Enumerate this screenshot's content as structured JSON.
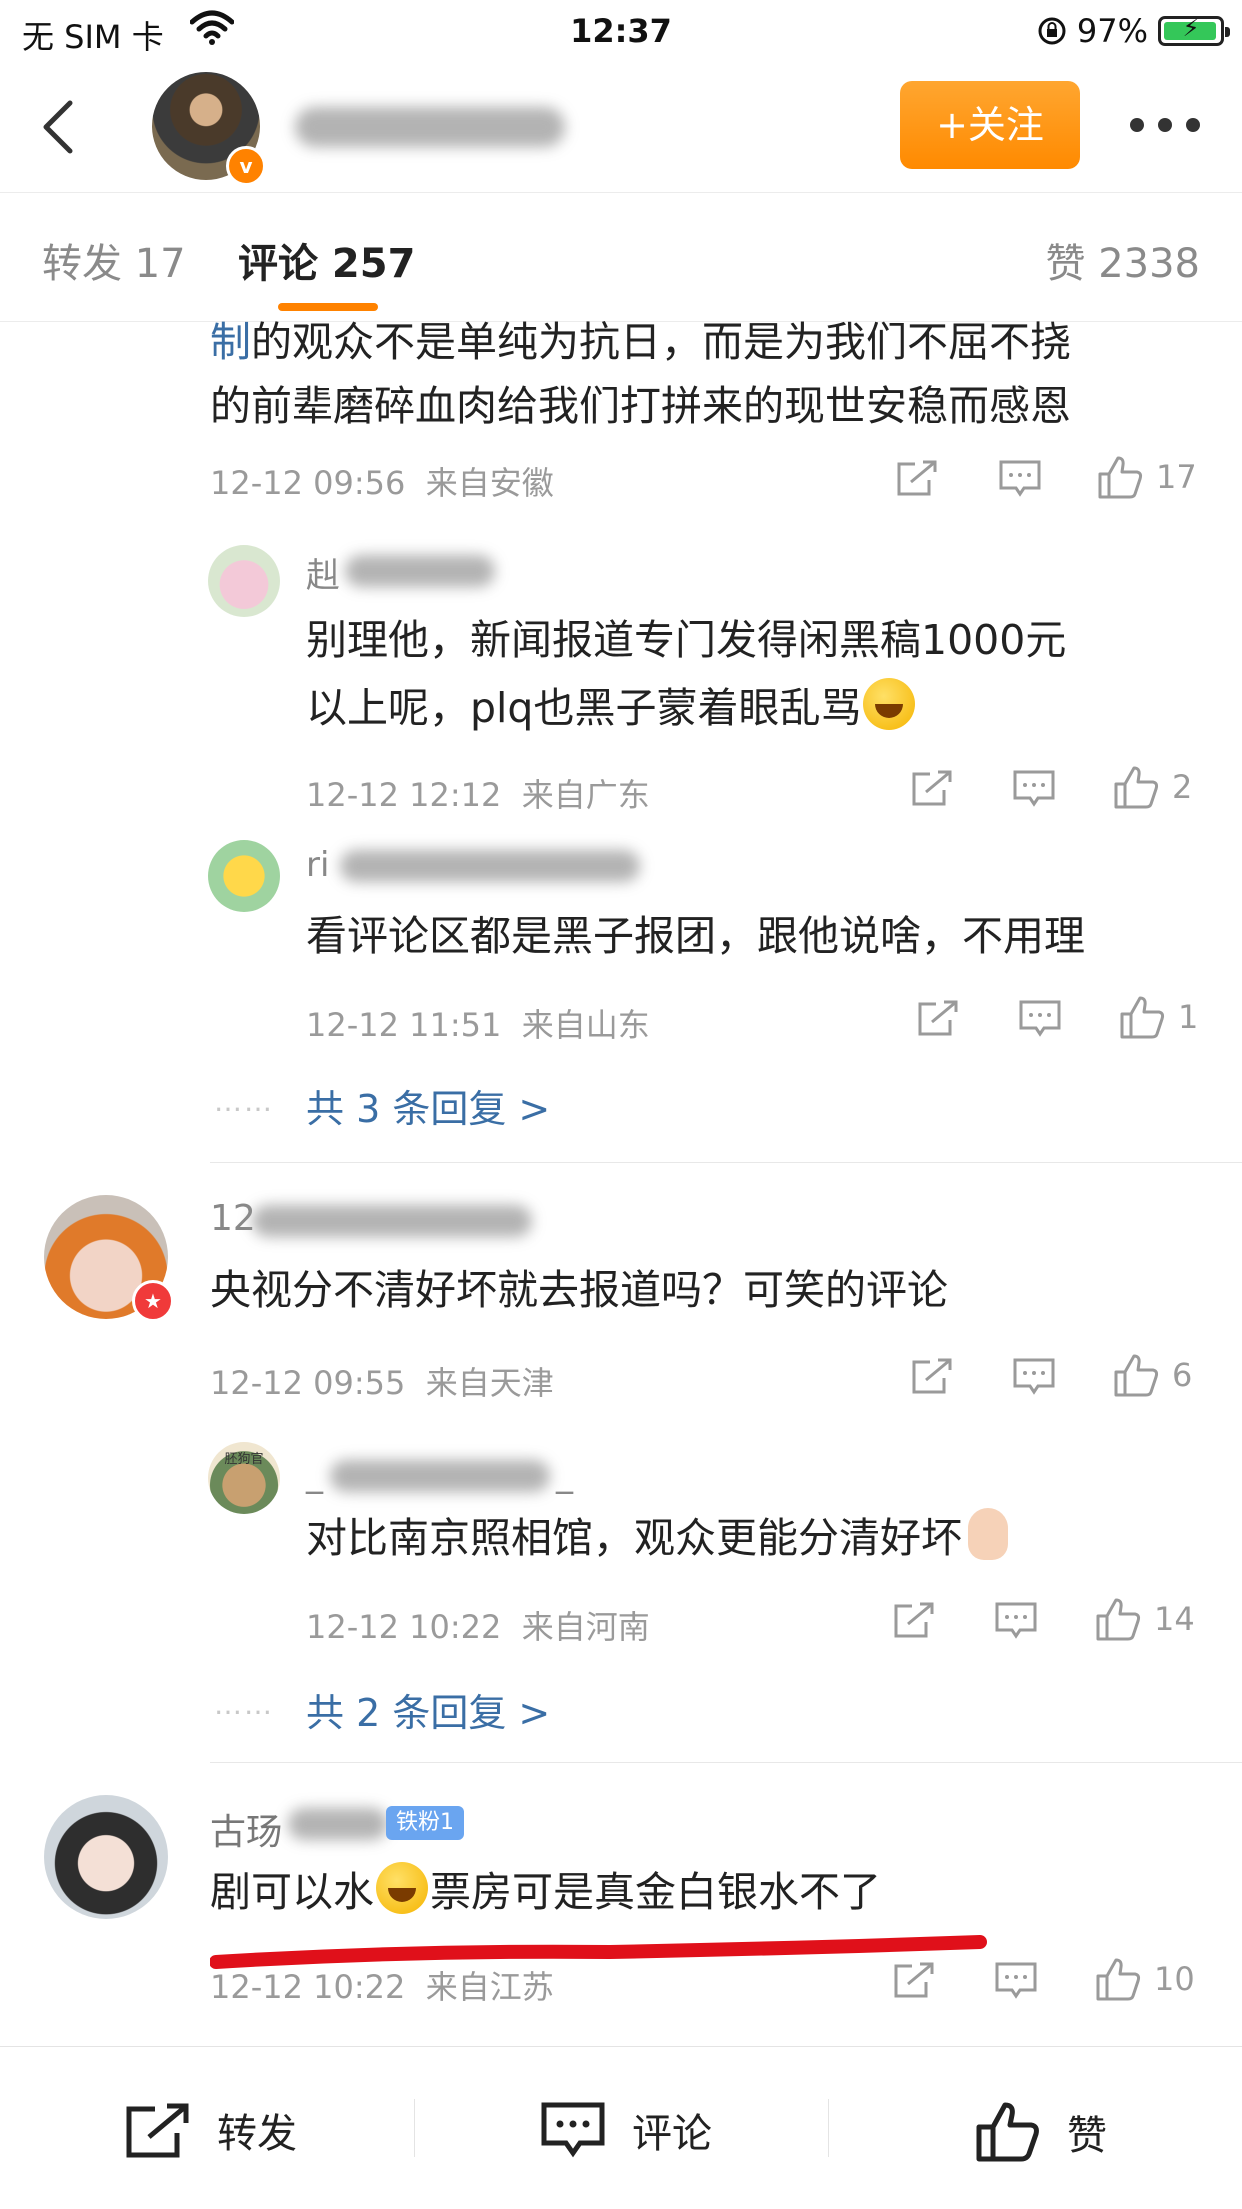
{
  "status_bar": {
    "carrier": "无 SIM 卡",
    "time": "12:37",
    "battery": "97%",
    "battery_level": 0.97
  },
  "nav": {
    "follow_label": "+关注"
  },
  "tabs": {
    "repost": "转发 17",
    "comments": "评论 257",
    "likes": "赞 2338"
  },
  "comments": [
    {
      "text_line1_highlight": "制",
      "text_line1_rest": "的观众不是单纯为抗日，而是为我们不屈不挠",
      "text_line2": "的前辈磨碎血肉给我们打拼来的现世安稳而感恩",
      "time": "12-12 09:56",
      "location": "来自安徽",
      "likes": "17",
      "replies": [
        {
          "name_prefix": "赳",
          "text_line1": "别理他，新闻报道专门发得闲黑稿1000元",
          "text_line2": "以上呢，plq也黑子蒙着眼乱骂",
          "time": "12-12 12:12",
          "location": "来自广东",
          "likes": "2"
        },
        {
          "name_prefix": "ri",
          "text": "看评论区都是黑子报团，跟他说啥，不用理",
          "time": "12-12 11:51",
          "location": "来自山东",
          "likes": "1"
        }
      ],
      "more_replies": "共 3 条回复 >"
    },
    {
      "name_prefix": "12",
      "text": "央视分不清好坏就去报道吗？可笑的评论",
      "time": "12-12 09:55",
      "location": "来自天津",
      "likes": "6",
      "replies": [
        {
          "name_prefix": "_",
          "name_suffix": "_",
          "avatar_label": "胚狗官",
          "text": "对比南京照相馆，观众更能分清好坏",
          "time": "12-12 10:22",
          "location": "来自河南",
          "likes": "14"
        }
      ],
      "more_replies": "共 2 条回复 >"
    },
    {
      "name_prefix": "古玚",
      "fan_badge": "铁粉1",
      "text_part1": "剧可以水",
      "text_part2": "票房可是真金白银水不了",
      "time": "12-12 10:22",
      "location": "来自江苏",
      "likes": "10"
    }
  ],
  "bottom_bar": {
    "repost": "转发",
    "comment": "评论",
    "like": "赞"
  },
  "colors": {
    "accent": "#ff8200",
    "link": "#3a6ea5",
    "annotation": "#e0101a"
  },
  "dots": "……"
}
